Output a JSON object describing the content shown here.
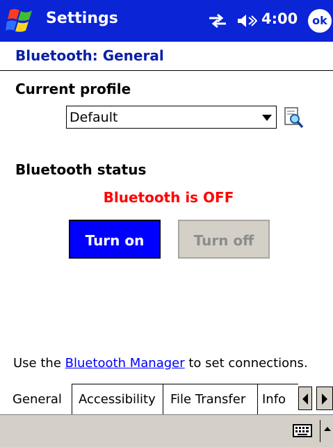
{
  "titlebar": {
    "title": "Settings",
    "time": "4:00",
    "ok_label": "ok"
  },
  "page": {
    "heading": "Bluetooth: General"
  },
  "profile": {
    "label": "Current profile",
    "value": "Default"
  },
  "status": {
    "label": "Bluetooth status",
    "text": "Bluetooth is OFF"
  },
  "buttons": {
    "turn_on": "Turn on",
    "turn_off": "Turn off"
  },
  "help": {
    "prefix": "Use the ",
    "link": "Bluetooth Manager",
    "suffix": " to set connections."
  },
  "tabs": [
    "General",
    "Accessibility",
    "File Transfer",
    "Info"
  ],
  "colors": {
    "titlebar": "#0a24d6",
    "heading": "#0a1fa8",
    "status_off": "#ff0000",
    "turn_on_bg": "#0000ff",
    "disabled_bg": "#d4d0c8"
  }
}
